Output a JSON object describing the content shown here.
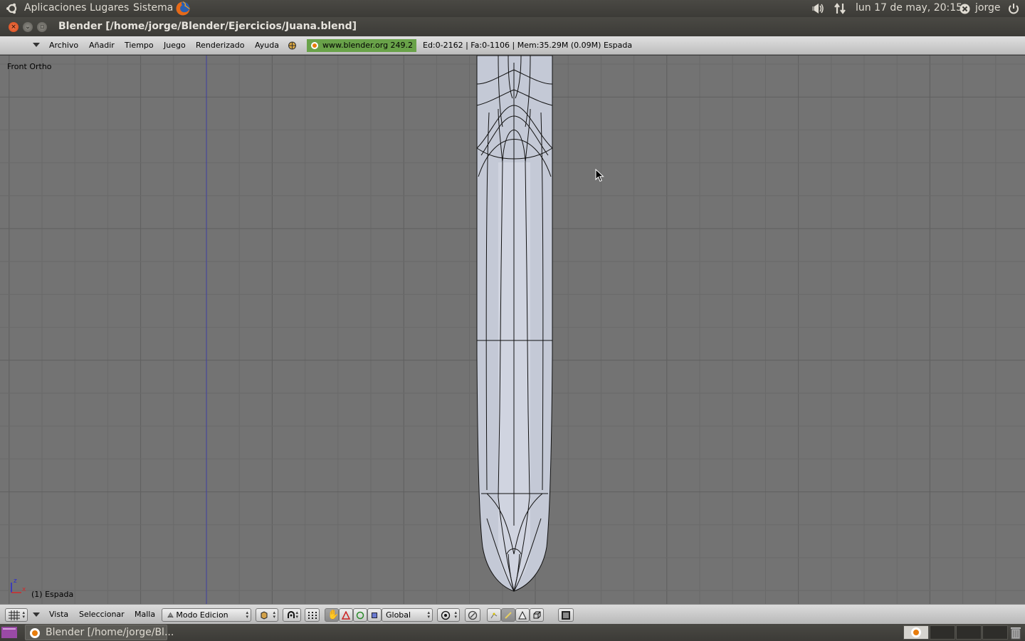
{
  "top_panel": {
    "menus": [
      "Aplicaciones",
      "Lugares",
      "Sistema"
    ],
    "datetime": "lun 17 de may, 20:15",
    "user": "jorge"
  },
  "window": {
    "title": "Blender [/home/jorge/Blender/Ejercicios/Juana.blend]",
    "close_glyph": "×",
    "min_glyph": "⌄",
    "max_glyph": "▫"
  },
  "info_header": {
    "menus": [
      "Archivo",
      "Añadir",
      "Tiempo",
      "Juego",
      "Renderizado",
      "Ayuda"
    ],
    "url": "www.blender.org 249.2",
    "stats": "Ed:0-2162 | Fa:0-1106 | Mem:35.29M (0.09M) Espada"
  },
  "viewport": {
    "view_name": "Front Ortho",
    "object_label": "(1) Espada",
    "axis_z": "z",
    "axis_x": "x"
  },
  "view_header": {
    "menus": [
      "Vista",
      "Seleccionar",
      "Malla"
    ],
    "mode": "Modo Edicion",
    "orientation": "Global"
  },
  "taskbar": {
    "task_label": "Blender [/home/jorge/Bl..."
  },
  "colors": {
    "viewport_bg": "#737373",
    "grid_line": "#666666",
    "mesh_fill": "#c4c9d6",
    "url_bg": "#69a249"
  }
}
